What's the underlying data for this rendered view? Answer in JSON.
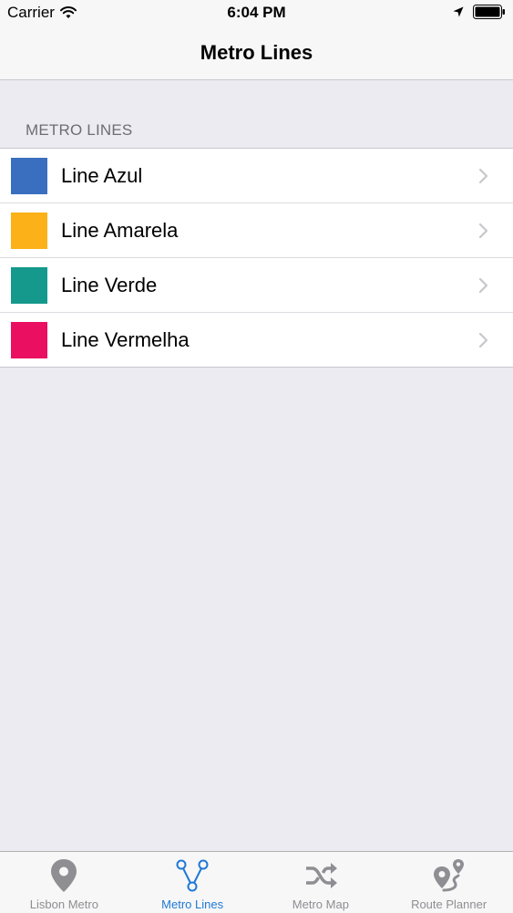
{
  "status_bar": {
    "carrier": "Carrier",
    "time": "6:04 PM"
  },
  "nav": {
    "title": "Metro Lines"
  },
  "section": {
    "header": "METRO LINES"
  },
  "lines": [
    {
      "label": "Line Azul",
      "color": "#3a6fbf"
    },
    {
      "label": "Line Amarela",
      "color": "#fbb117"
    },
    {
      "label": "Line Verde",
      "color": "#14998c"
    },
    {
      "label": "Line Vermelha",
      "color": "#ea0f61"
    }
  ],
  "tab_bar": {
    "tabs": [
      {
        "label": "Lisbon Metro",
        "icon": "map-pin-icon",
        "active": false
      },
      {
        "label": "Metro Lines",
        "icon": "metro-lines-icon",
        "active": true
      },
      {
        "label": "Metro Map",
        "icon": "shuffle-icon",
        "active": false
      },
      {
        "label": "Route Planner",
        "icon": "route-planner-icon",
        "active": false
      }
    ]
  },
  "colors": {
    "active_tab": "#1f79d6",
    "inactive_tab": "#8e8e93"
  }
}
